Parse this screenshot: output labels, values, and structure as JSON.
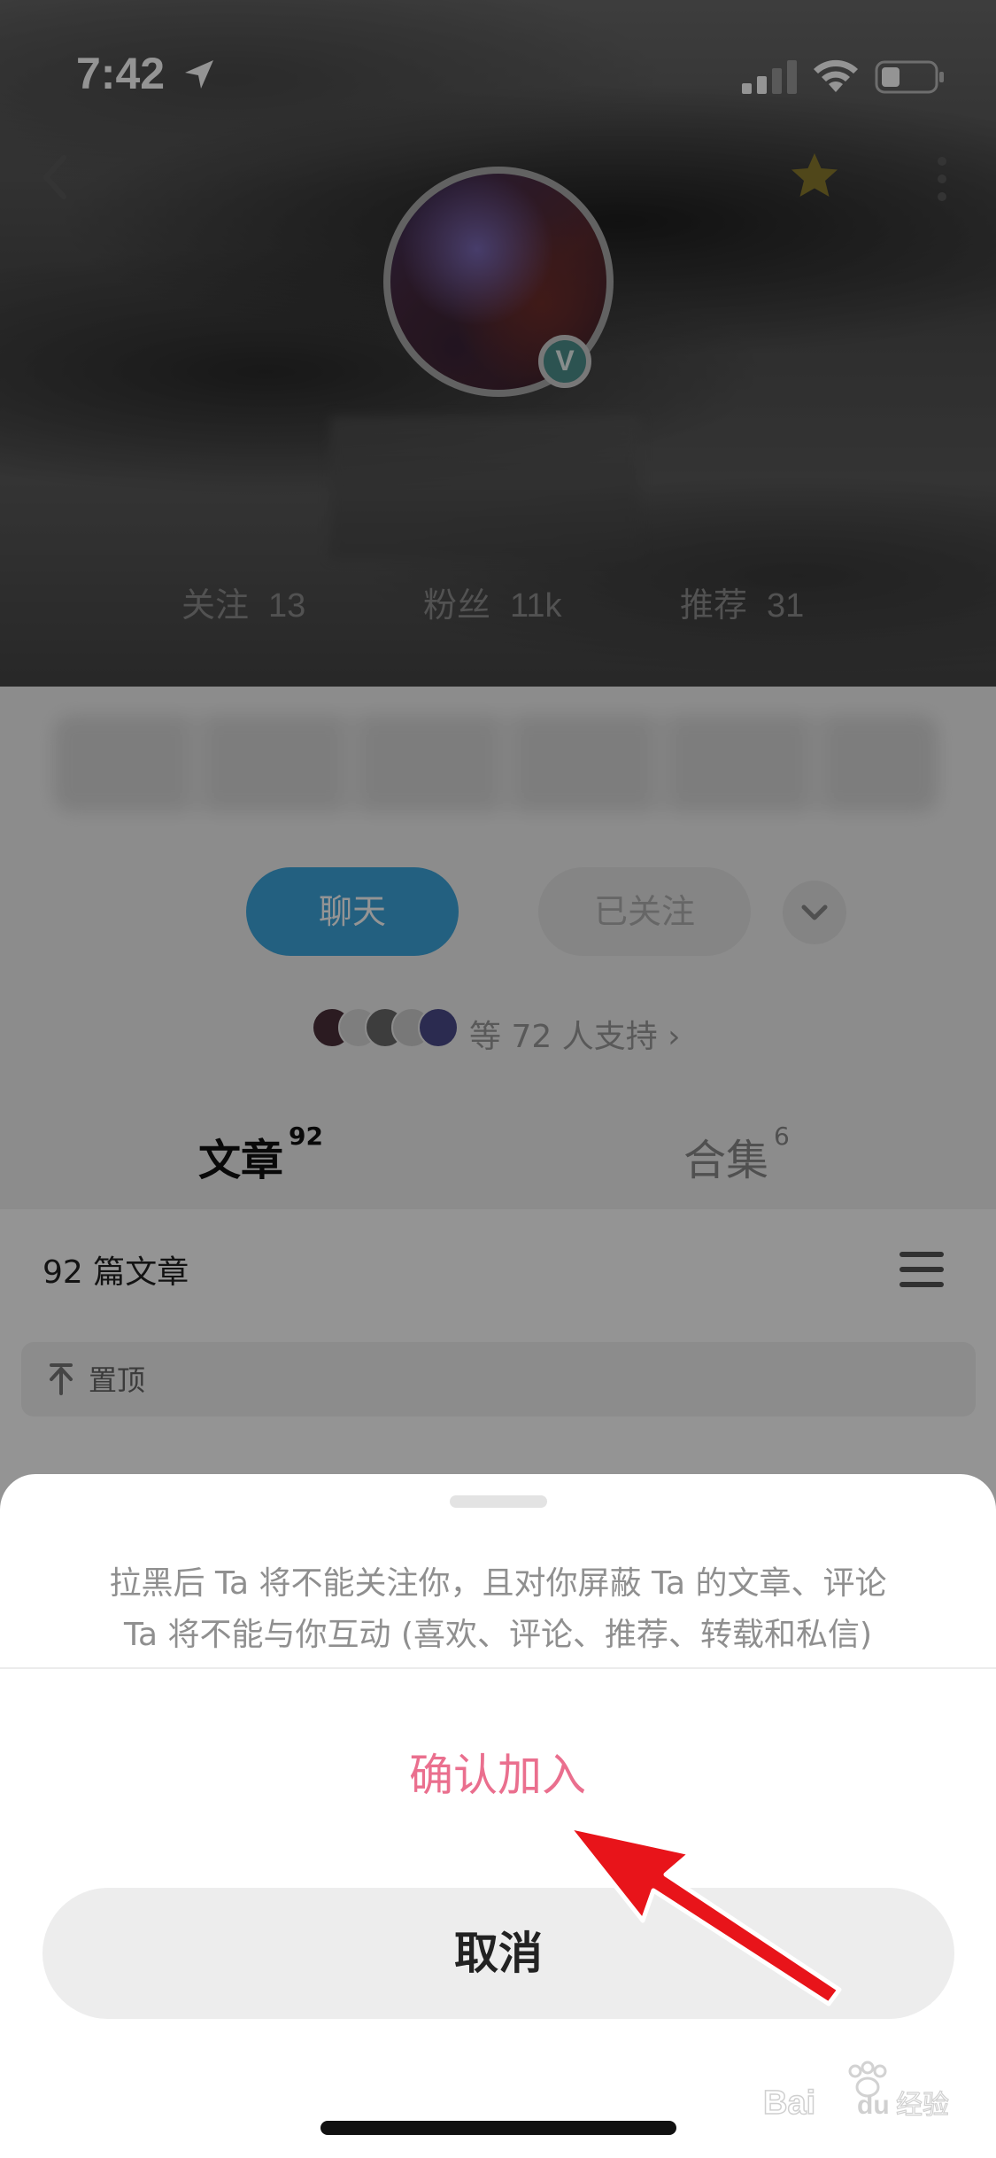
{
  "status_bar": {
    "time": "7:42"
  },
  "profile": {
    "verified_badge": "V",
    "stats": [
      {
        "label": "关注",
        "value": "13"
      },
      {
        "label": "粉丝",
        "value": "11k"
      },
      {
        "label": "推荐",
        "value": "31"
      }
    ],
    "chat_label": "聊天",
    "follow_label": "已关注",
    "supporters_text": "等 72 人支持 ›",
    "tabs": [
      {
        "label": "文章",
        "count": "92"
      },
      {
        "label": "合集",
        "count": "6"
      }
    ],
    "article_count": "92 篇文章",
    "pinned_label": "置顶"
  },
  "sheet": {
    "message_line1": "拉黑后 Ta 将不能关注你，且对你屏蔽 Ta 的文章、评论",
    "message_line2": "Ta 将不能与你互动 (喜欢、评论、推荐、转载和私信)",
    "confirm_label": "确认加入",
    "cancel_label": "取消"
  },
  "colors": {
    "accent_blue": "#3da6dc",
    "confirm_pink": "#ea6f8e",
    "annotation_red": "#e8141a",
    "star_gold": "#8a7a2e"
  },
  "watermark": {
    "text": "Baidu经验"
  }
}
